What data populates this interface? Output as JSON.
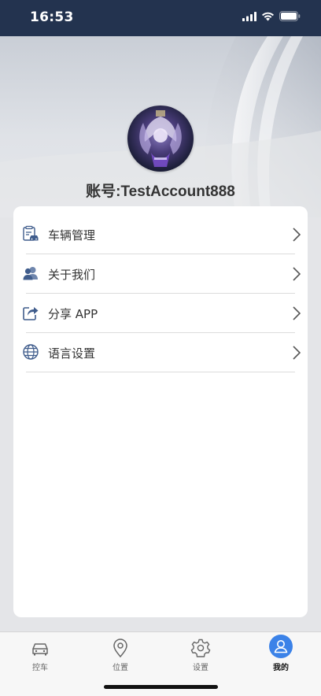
{
  "status_bar": {
    "time": "16:53"
  },
  "profile": {
    "account_line": "账号:TestAccount888"
  },
  "menu": {
    "items": [
      {
        "label": "车辆管理",
        "icon": "vehicle-manage-icon"
      },
      {
        "label": "关于我们",
        "icon": "users-icon"
      },
      {
        "label": "分享 APP",
        "icon": "share-icon"
      },
      {
        "label": "语言设置",
        "icon": "globe-icon"
      }
    ]
  },
  "tab_bar": {
    "tabs": [
      {
        "label": "控车",
        "icon": "car-icon",
        "active": false
      },
      {
        "label": "位置",
        "icon": "location-pin-icon",
        "active": false
      },
      {
        "label": "设置",
        "icon": "gear-icon",
        "active": false
      },
      {
        "label": "我的",
        "icon": "person-icon",
        "active": true
      }
    ]
  },
  "colors": {
    "status_bar_bg": "#23334f",
    "accent": "#3b82e8",
    "icon_blue": "#3f5c8c"
  }
}
